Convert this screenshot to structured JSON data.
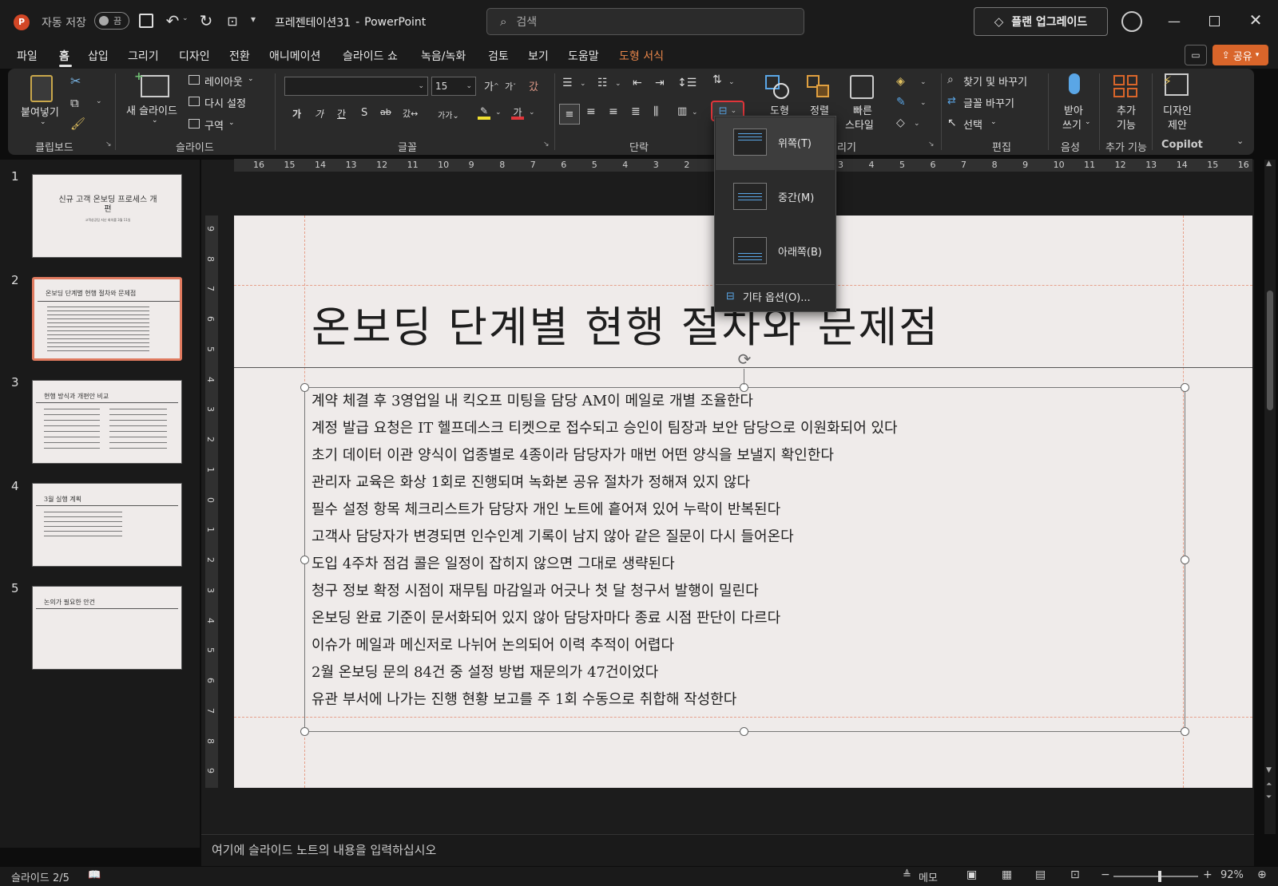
{
  "titlebar": {
    "autosave_label": "자동 저장",
    "autosave_state": "끔",
    "doc_title": "프레젠테이션31",
    "app_name": "PowerPoint",
    "separator": "-",
    "search_placeholder": "검색",
    "upgrade_label": "플랜 업그레이드"
  },
  "menu": {
    "tabs": [
      "파일",
      "홈",
      "삽입",
      "그리기",
      "디자인",
      "전환",
      "애니메이션",
      "슬라이드 쇼",
      "녹음/녹화",
      "검토",
      "보기",
      "도움말",
      "도형 서식"
    ],
    "active_tab": "홈",
    "contextual_tab_color": "#e8864a",
    "share_label": "공유"
  },
  "ribbon": {
    "clipboard": {
      "paste": "붙여넣기",
      "group": "클립보드"
    },
    "slides": {
      "new_slide": "새 슬라이드",
      "layout": "레이아웃",
      "reset": "다시 설정",
      "section": "구역",
      "group": "슬라이드"
    },
    "font": {
      "font_name": "",
      "font_size": "15",
      "group": "글꼴"
    },
    "paragraph": {
      "group": "단락"
    },
    "drawing": {
      "shapes": "도형",
      "arrange": "정렬",
      "quick_styles": "빠른",
      "quick_styles2": "스타일",
      "group_partial": "리기"
    },
    "editing": {
      "find_replace": "찾기 및 바꾸기",
      "replace_font": "글꼴 바꾸기",
      "select": "선택",
      "group": "편집"
    },
    "voice": {
      "dictate": "받아",
      "dictate2": "쓰기",
      "group": "음성"
    },
    "addins": {
      "label": "추가",
      "label2": "기능",
      "group": "추가 기능"
    },
    "designer": {
      "label": "디자인",
      "label2": "제안",
      "group": "Copilot"
    }
  },
  "align_dropdown": {
    "items": [
      {
        "label": "위쪽(T)",
        "selected": true
      },
      {
        "label": "중간(M)",
        "selected": false
      },
      {
        "label": "아래쪽(B)",
        "selected": false
      }
    ],
    "more_options": "기타 옵션(O)..."
  },
  "thumbnails": [
    {
      "num": "1",
      "title": "신규 고객 온보딩 프로세스 개편",
      "sub": "고객성공팀 지난 회의를 3월 11일"
    },
    {
      "num": "2",
      "title": "온보딩 단계별 현행 절차와 문제점",
      "selected": true
    },
    {
      "num": "3",
      "title": "현행 방식과 개편안 비교"
    },
    {
      "num": "4",
      "title": "3월 실행 계획"
    },
    {
      "num": "5",
      "title": "논의가 필요한 안건"
    }
  ],
  "slide": {
    "title": "온보딩 단계별 현행 절차와 문제점",
    "bullets": [
      "계약 체결 후 3영업일 내 킥오프 미팅을 담당 AM이 메일로 개별 조율한다",
      "계정 발급 요청은 IT 헬프데스크 티켓으로 접수되고 승인이 팀장과 보안 담당으로 이원화되어 있다",
      "초기 데이터 이관 양식이 업종별로 4종이라 담당자가 매번 어떤 양식을 보낼지 확인한다",
      "관리자 교육은 화상 1회로 진행되며 녹화본 공유 절차가 정해져 있지 않다",
      "필수 설정 항목 체크리스트가 담당자 개인 노트에 흩어져 있어 누락이 반복된다",
      "고객사 담당자가 변경되면 인수인계 기록이 남지 않아 같은 질문이 다시 들어온다",
      "도입 4주차 점검 콜은 일정이 잡히지 않으면 그대로 생략된다",
      "청구 정보 확정 시점이 재무팀 마감일과 어긋나 첫 달 청구서 발행이 밀린다",
      "온보딩 완료 기준이 문서화되어 있지 않아 담당자마다 종료 시점 판단이 다르다",
      "이슈가 메일과 메신저로 나뉘어 논의되어 이력 추적이 어렵다",
      "2월 온보딩 문의 84건 중 설정 방법 재문의가 47건이었다",
      "유관 부서에 나가는 진행 현황 보고를 주 1회 수동으로 취합해 작성한다"
    ]
  },
  "ruler": {
    "h": [
      "16",
      "15",
      "14",
      "13",
      "12",
      "11",
      "10",
      "9",
      "8",
      "7",
      "6",
      "5",
      "4",
      "3",
      "2",
      "1",
      "0",
      "1",
      "2",
      "3",
      "4",
      "5",
      "6",
      "7",
      "8",
      "9",
      "10",
      "11",
      "12",
      "13",
      "14",
      "15",
      "16"
    ],
    "v": [
      "9",
      "8",
      "7",
      "6",
      "5",
      "4",
      "3",
      "2",
      "1",
      "0",
      "1",
      "2",
      "3",
      "4",
      "5",
      "6",
      "7",
      "8",
      "9"
    ]
  },
  "notes_placeholder": "여기에 슬라이드 노트의 내용을 입력하십시오",
  "status": {
    "slide_counter": "슬라이드 2/5",
    "notes_label": "메모",
    "zoom": "92%",
    "zoom_fraction": 0.55
  },
  "colors": {
    "accent_red": "#e0353a",
    "orange": "#d9652a"
  }
}
